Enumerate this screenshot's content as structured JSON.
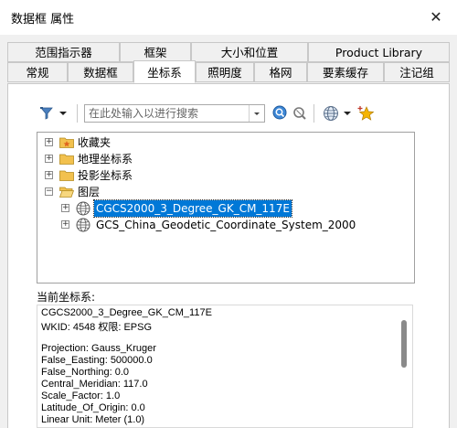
{
  "window": {
    "title": "数据框 属性",
    "close_glyph": "✕"
  },
  "tabs_row1": [
    "范围指示器",
    "框架",
    "大小和位置",
    "Product Library"
  ],
  "tabs_row2": [
    "常规",
    "数据框",
    "坐标系",
    "照明度",
    "格网",
    "要素缓存",
    "注记组"
  ],
  "active_tab": "坐标系",
  "toolbar": {
    "filter_icon": "filter-icon",
    "search_placeholder": "在此处输入以进行搜索",
    "search_value": ""
  },
  "tree": {
    "items": [
      {
        "label": "收藏夹",
        "expander": "+",
        "icon": "favorites-folder-icon"
      },
      {
        "label": "地理坐标系",
        "expander": "+",
        "icon": "folder-icon"
      },
      {
        "label": "投影坐标系",
        "expander": "+",
        "icon": "folder-icon"
      },
      {
        "label": "图层",
        "expander": "−",
        "icon": "open-folder-icon"
      },
      {
        "label": "CGCS2000_3_Degree_GK_CM_117E",
        "expander": "+",
        "icon": "globe-icon",
        "selected": true
      },
      {
        "label": "GCS_China_Geodetic_Coordinate_System_2000",
        "expander": "+",
        "icon": "globe-icon"
      }
    ]
  },
  "current_cs": {
    "label": "当前坐标系:",
    "lines": [
      "CGCS2000_3_Degree_GK_CM_117E",
      "WKID: 4548 权限: EPSG",
      "",
      "Projection: Gauss_Kruger",
      "False_Easting: 500000.0",
      "False_Northing: 0.0",
      "Central_Meridian: 117.0",
      "Scale_Factor: 1.0",
      "Latitude_Of_Origin: 0.0",
      "Linear Unit: Meter (1.0)"
    ]
  },
  "colors": {
    "selection": "#0078d7",
    "star": "#f5b400"
  }
}
